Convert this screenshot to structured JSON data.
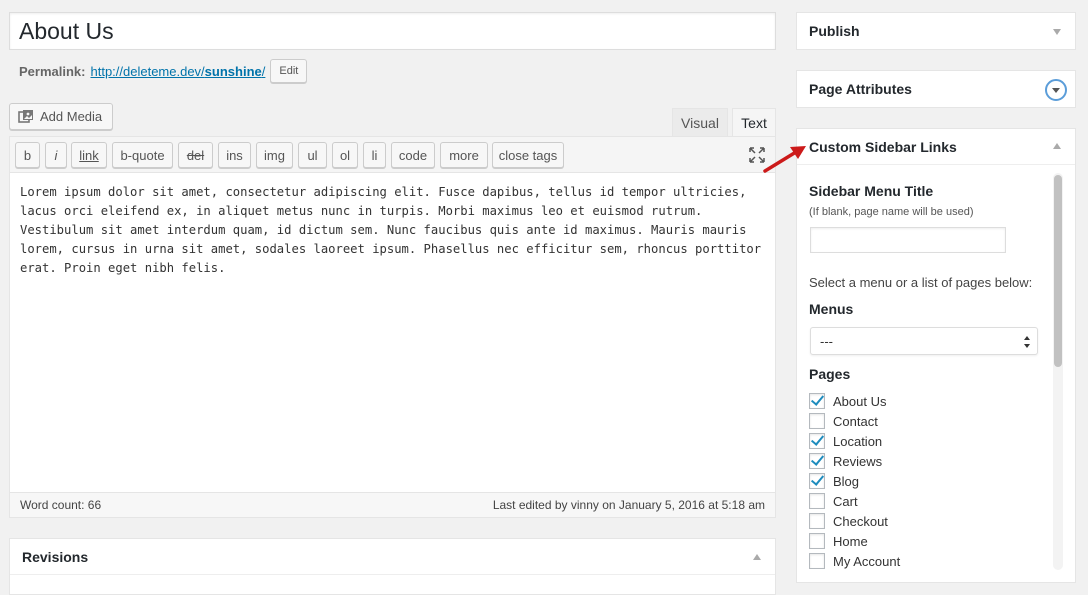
{
  "title": "About Us",
  "permalink": {
    "label": "Permalink:",
    "url_base": "http://deleteme.dev/",
    "url_slug": "sunshine",
    "url_end": "/",
    "edit_label": "Edit"
  },
  "add_media_label": "Add Media",
  "tabs": {
    "visual": "Visual",
    "text": "Text"
  },
  "quicktags": [
    "b",
    "i",
    "link",
    "b-quote",
    "del",
    "ins",
    "img",
    "ul",
    "ol",
    "li",
    "code",
    "more",
    "close tags"
  ],
  "content": "Lorem ipsum dolor sit amet, consectetur adipiscing elit. Fusce dapibus, tellus id tempor ultricies, lacus orci eleifend ex, in aliquet metus nunc in turpis. Morbi maximus leo et euismod rutrum. Vestibulum sit amet interdum quam, id dictum sem. Nunc faucibus quis ante id maximus. Mauris mauris lorem, cursus in urna sit amet, sodales laoreet ipsum. Phasellus nec efficitur sem, rhoncus porttitor erat. Proin eget nibh felis.",
  "word_count": "Word count: 66",
  "last_edited": "Last edited by vinny on January 5, 2016 at 5:18 am",
  "revisions_title": "Revisions",
  "sidebar": {
    "publish_title": "Publish",
    "attributes_title": "Page Attributes",
    "custom_title": "Custom Sidebar Links",
    "menu_title_label": "Sidebar Menu Title",
    "menu_title_hint": "(If blank, page name will be used)",
    "menu_title_value": "",
    "select_prompt": "Select a menu or a list of pages below:",
    "menus_label": "Menus",
    "menus_selected": "---",
    "pages_label": "Pages",
    "pages": [
      {
        "label": "About Us",
        "checked": true
      },
      {
        "label": "Contact",
        "checked": false
      },
      {
        "label": "Location",
        "checked": true
      },
      {
        "label": "Reviews",
        "checked": true
      },
      {
        "label": "Blog",
        "checked": true
      },
      {
        "label": "Cart",
        "checked": false
      },
      {
        "label": "Checkout",
        "checked": false
      },
      {
        "label": "Home",
        "checked": false
      },
      {
        "label": "My Account",
        "checked": false
      }
    ]
  },
  "colors": {
    "link": "#0073aa",
    "checkmark": "#1e8cbe",
    "annotation_arrow": "#cc1a1a"
  }
}
